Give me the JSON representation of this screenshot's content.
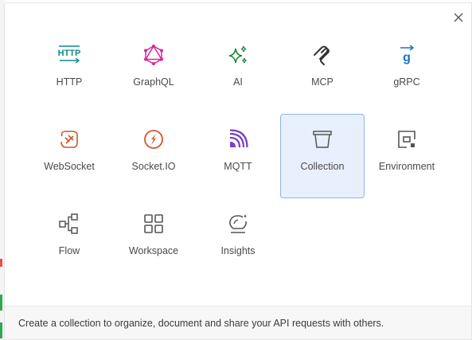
{
  "dialog": {
    "close_icon": "close-icon",
    "items": [
      {
        "id": "http",
        "label": "HTTP",
        "icon": "http-icon",
        "color": "#0f8a8a"
      },
      {
        "id": "graphql",
        "label": "GraphQL",
        "icon": "graphql-icon",
        "color": "#d6289b"
      },
      {
        "id": "ai",
        "label": "AI",
        "icon": "sparkles-icon",
        "color": "#1f8a3a"
      },
      {
        "id": "mcp",
        "label": "MCP",
        "icon": "mcp-icon",
        "color": "#333333"
      },
      {
        "id": "grpc",
        "label": "gRPC",
        "icon": "grpc-icon",
        "color": "#1a73c9"
      },
      {
        "id": "websocket",
        "label": "WebSocket",
        "icon": "websocket-icon",
        "color": "#d2552a"
      },
      {
        "id": "socketio",
        "label": "Socket.IO",
        "icon": "socketio-icon",
        "color": "#d2552a"
      },
      {
        "id": "mqtt",
        "label": "MQTT",
        "icon": "mqtt-icon",
        "color": "#7a3fc4"
      },
      {
        "id": "collection",
        "label": "Collection",
        "icon": "collection-icon",
        "color": "#555555",
        "selected": true
      },
      {
        "id": "environment",
        "label": "Environment",
        "icon": "environment-icon",
        "color": "#555555"
      },
      {
        "id": "flow",
        "label": "Flow",
        "icon": "flow-icon",
        "color": "#555555"
      },
      {
        "id": "workspace",
        "label": "Workspace",
        "icon": "workspace-icon",
        "color": "#555555"
      },
      {
        "id": "insights",
        "label": "Insights",
        "icon": "insights-icon",
        "color": "#555555"
      }
    ],
    "footer_text": "Create a collection to organize, document and share your API requests with others."
  }
}
